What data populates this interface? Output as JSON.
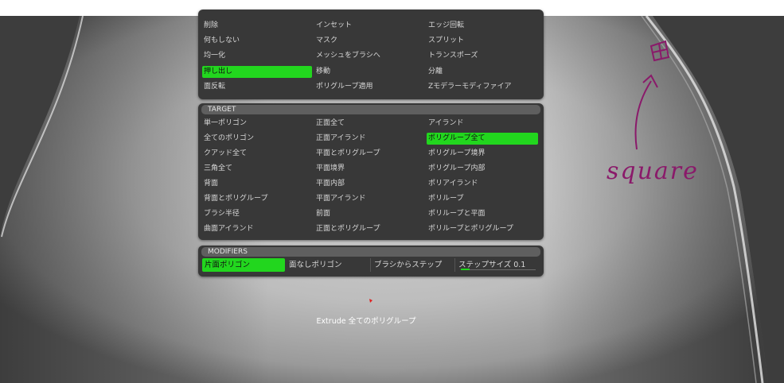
{
  "deformation": {
    "rows": [
      [
        "削除",
        "インセット",
        "エッジ回転"
      ],
      [
        "何もしない",
        "マスク",
        "スプリット"
      ],
      [
        "均一化",
        "メッシュをブラシへ",
        "トランスポーズ"
      ],
      [
        "押し出し",
        "移動",
        "分離"
      ],
      [
        "面反転",
        "ポリグループ適用",
        "Zモデラーモディファイア"
      ]
    ],
    "active": "押し出し"
  },
  "target": {
    "header": "TARGET",
    "rows": [
      [
        "単一ポリゴン",
        "正面全て",
        "アイランド"
      ],
      [
        "全てのポリゴン",
        "正面アイランド",
        "ポリグループ全て"
      ],
      [
        "クアッド全て",
        "平面とポリグループ",
        "ポリグループ境界"
      ],
      [
        "三角全て",
        "平面境界",
        "ポリグループ内部"
      ],
      [
        "背面",
        "平面内部",
        "ポリアイランド"
      ],
      [
        "背面とポリグループ",
        "平面アイランド",
        "ポリループ"
      ],
      [
        "ブラシ半径",
        "前面",
        "ポリループと平面"
      ],
      [
        "曲面アイランド",
        "正面とポリグループ",
        "ポリループとポリグループ"
      ]
    ],
    "active": "ポリグループ全て"
  },
  "modifiers": {
    "header": "MODIFIERS",
    "items": [
      "片面ポリゴン",
      "面なしポリゴン",
      "ブラシからステップ",
      "ステップサイズ 0.1"
    ],
    "active": "片面ポリゴン",
    "step_size_fill": 0.12
  },
  "status": {
    "action": "Extrude",
    "target": "全てのポリグループ"
  },
  "annotation": {
    "text": "square",
    "color": "#8a1a6a"
  },
  "colors": {
    "accent": "#22d61e",
    "panel": "#383838",
    "header": "#5f5f5f",
    "background": "#3d3d3d"
  }
}
